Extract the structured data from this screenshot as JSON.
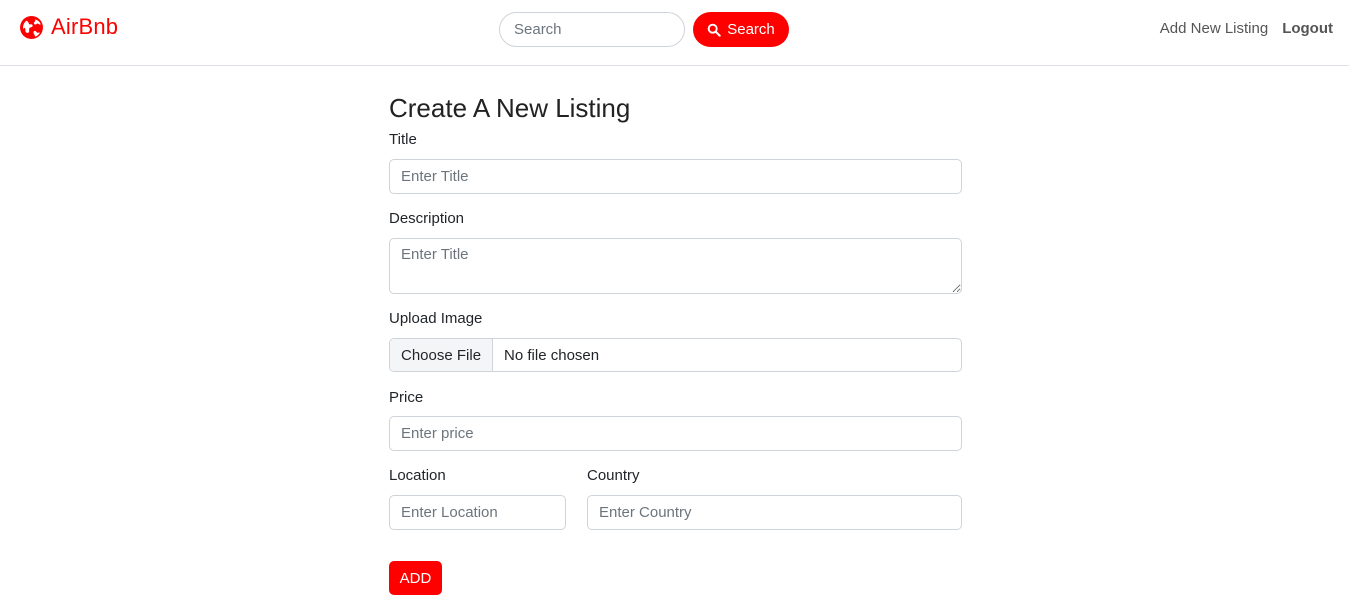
{
  "navbar": {
    "brand_name": "AirBnb",
    "brand_icon": "globe-icon",
    "search_placeholder": "Search",
    "search_button_label": "Search",
    "search_button_icon": "search-icon",
    "links": {
      "add_listing": "Add New Listing",
      "logout": "Logout"
    }
  },
  "form": {
    "title": "Create A New Listing",
    "fields": {
      "title": {
        "label": "Title",
        "placeholder": "Enter Title"
      },
      "description": {
        "label": "Description",
        "placeholder": "Enter Title"
      },
      "image": {
        "label": "Upload Image",
        "button_label": "Choose File",
        "status": "No file chosen"
      },
      "price": {
        "label": "Price",
        "placeholder": "Enter price"
      },
      "location": {
        "label": "Location",
        "placeholder": "Enter Location"
      },
      "country": {
        "label": "Country",
        "placeholder": "Enter Country"
      }
    },
    "submit_label": "ADD"
  },
  "colors": {
    "accent": "#fe0000",
    "border": "#ced4da"
  }
}
